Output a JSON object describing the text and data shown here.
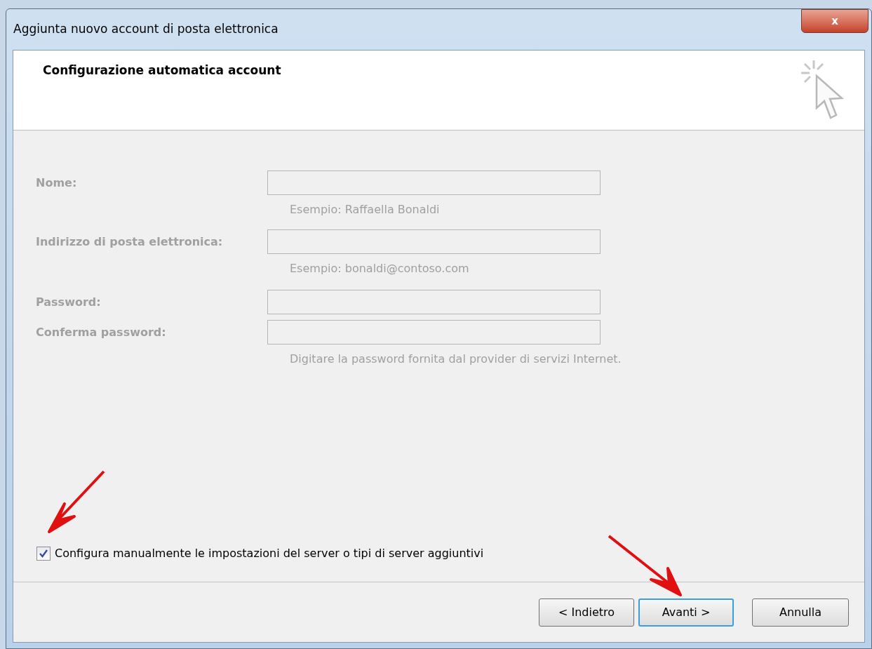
{
  "window": {
    "title": "Aggiunta nuovo account di posta elettronica",
    "close": "x"
  },
  "header": {
    "title": "Configurazione automatica account"
  },
  "fields": [
    {
      "label": "Nome:",
      "disabled": true,
      "hint": "Esempio: Raffaella Bonaldi"
    },
    {
      "label": "Indirizzo di posta elettronica:",
      "disabled": true,
      "hint": "Esempio: bonaldi@contoso.com"
    },
    {
      "label": "Password:",
      "disabled": true
    },
    {
      "label": "Conferma password:",
      "disabled": true,
      "hint": "Digitare la password fornita dal provider di servizi Internet."
    }
  ],
  "manual_setup": {
    "label": "Configura manualmente le impostazioni del server o tipi di server aggiuntivi",
    "checked": true
  },
  "buttons": [
    {
      "label": "< Indietro",
      "focused": false
    },
    {
      "label": "Avanti >",
      "focused": true
    },
    {
      "label": "Annulla",
      "focused": false
    }
  ]
}
